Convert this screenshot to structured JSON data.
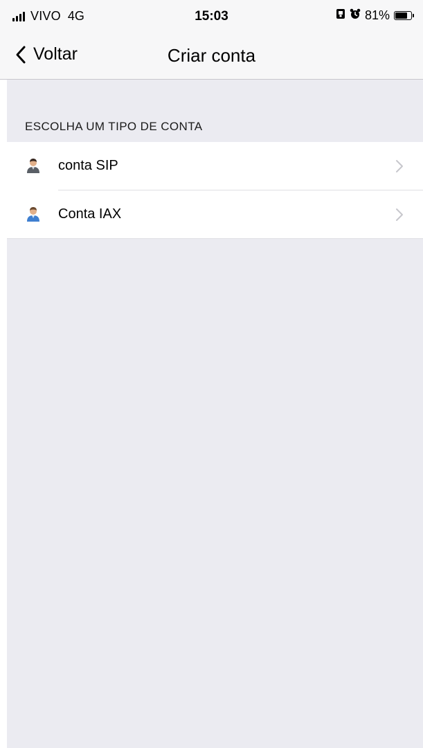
{
  "status_bar": {
    "carrier": "VIVO",
    "network": "4G",
    "time": "15:03",
    "battery_percent": "81%",
    "battery_level": 0.81
  },
  "nav": {
    "back_label": "Voltar",
    "title": "Criar conta"
  },
  "section": {
    "header": "ESCOLHA UM TIPO DE CONTA"
  },
  "accounts": [
    {
      "label": "conta SIP",
      "icon": "user-avatar-icon"
    },
    {
      "label": "Conta IAX",
      "icon": "user-avatar-icon"
    }
  ],
  "colors": {
    "bar_background": "#f7f7f8",
    "content_background": "#ebebf1",
    "separator": "#dedee3",
    "chevron": "#c7c7cc"
  }
}
